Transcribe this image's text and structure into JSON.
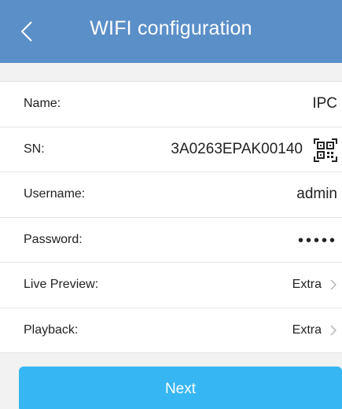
{
  "header": {
    "title": "WIFI configuration",
    "background_color": "#5b8fc8",
    "back_icon": "chevron-left-icon"
  },
  "form": {
    "name": {
      "label": "Name:",
      "value": "IPC"
    },
    "sn": {
      "label": "SN:",
      "value": "3A0263EPAK00140",
      "icon": "qr-code-icon"
    },
    "username": {
      "label": "Username:",
      "value": "admin"
    },
    "password": {
      "label": "Password:",
      "value": "•••••"
    },
    "live_preview": {
      "label": "Live Preview:",
      "value": "Extra",
      "icon": "chevron-right-icon"
    },
    "playback": {
      "label": "Playback:",
      "value": "Extra",
      "icon": "chevron-right-icon"
    }
  },
  "footer": {
    "next_label": "Next",
    "button_color": "#36b6f2"
  }
}
